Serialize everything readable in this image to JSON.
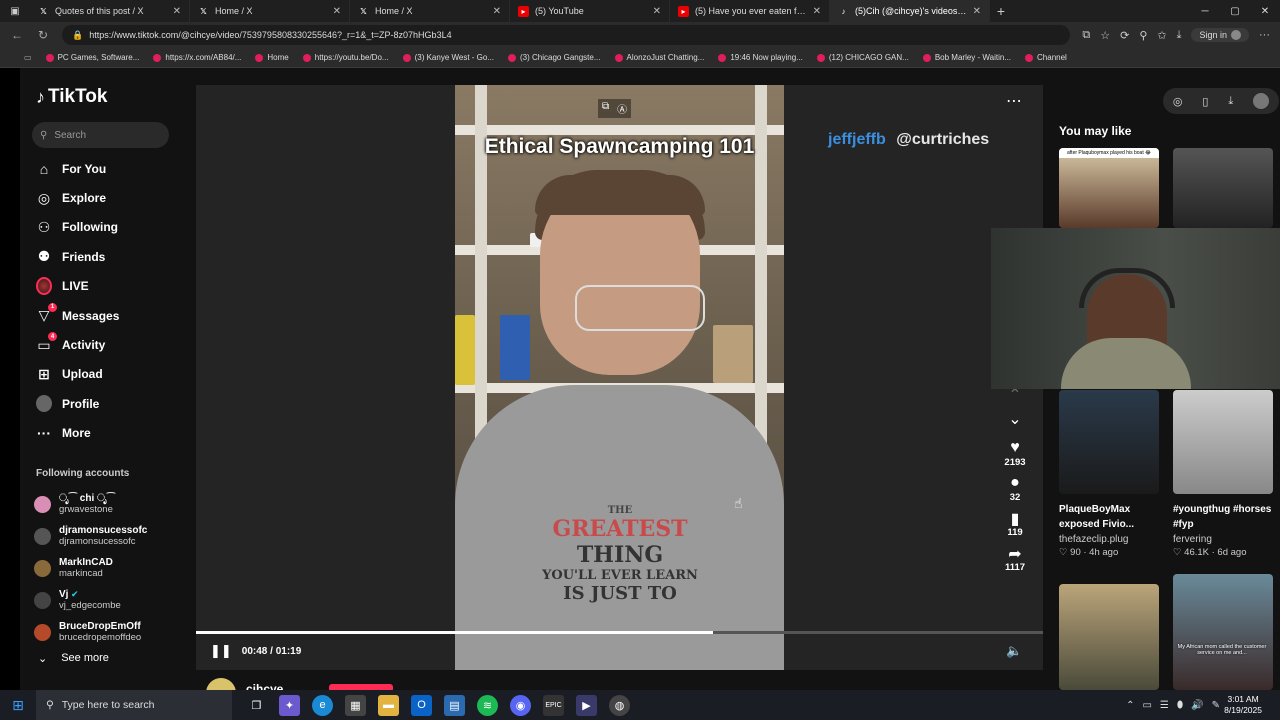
{
  "browser": {
    "tabs": [
      {
        "label": "Quotes of this post / X",
        "icon": "x-logo-icon",
        "active": false
      },
      {
        "label": "Home / X",
        "icon": "x-logo-icon",
        "active": false
      },
      {
        "label": "Home / X",
        "icon": "x-logo-icon",
        "active": false
      },
      {
        "label": "(5) YouTube",
        "icon": "youtube-icon",
        "active": false
      },
      {
        "label": "(5) Have you ever eaten fish this",
        "icon": "youtube-icon",
        "active": false
      },
      {
        "label": "(5)Cih (@cihcye)'s videos wi",
        "icon": "tiktok-icon",
        "active": true
      }
    ],
    "url": "https://www.tiktok.com/@cihcye/video/7539795808330255646?_r=1&_t=ZP-8z07hHGb3L4",
    "signin_label": "Sign in",
    "bookmarks": [
      {
        "label": "PC Games, Software..."
      },
      {
        "label": "https://x.com/AB84/..."
      },
      {
        "label": "Home"
      },
      {
        "label": "https://youtu.be/Do..."
      },
      {
        "label": "(3) Kanye West - Go..."
      },
      {
        "label": "(3) Chicago Gangste..."
      },
      {
        "label": "AlonzoJust Chatting..."
      },
      {
        "label": "19:46 Now playing..."
      },
      {
        "label": "(12) CHICAGO GAN..."
      },
      {
        "label": "Bob Marley - Waitin..."
      },
      {
        "label": "Channel"
      }
    ]
  },
  "sidebar": {
    "logo": "TikTok",
    "search_placeholder": "Search",
    "nav": [
      {
        "label": "For You",
        "icon": "home-icon"
      },
      {
        "label": "Explore",
        "icon": "compass-icon"
      },
      {
        "label": "Following",
        "icon": "following-icon"
      },
      {
        "label": "Friends",
        "icon": "friends-icon"
      },
      {
        "label": "LIVE",
        "icon": "live-avatar-icon"
      },
      {
        "label": "Messages",
        "icon": "messages-icon",
        "badge": "1"
      },
      {
        "label": "Activity",
        "icon": "activity-icon",
        "badge": "4"
      },
      {
        "label": "Upload",
        "icon": "upload-icon"
      },
      {
        "label": "Profile",
        "icon": "profile-avatar-icon"
      },
      {
        "label": "More",
        "icon": "more-dots-icon"
      }
    ],
    "following_title": "Following accounts",
    "following": [
      {
        "name": "ೃ⁀ chi ೃ⁀",
        "handle": "grwavestone",
        "color": "#d98fb5"
      },
      {
        "name": "djramonsucessofc",
        "handle": "djramonsucessofc",
        "color": "#555"
      },
      {
        "name": "MarkInCAD",
        "handle": "markincad",
        "color": "#8a6a3a"
      },
      {
        "name": "Vj",
        "handle": "vj_edgecombe",
        "color": "#444",
        "verified": true
      },
      {
        "name": "BruceDropEmOff",
        "handle": "brucedropemoffdeo",
        "color": "#b54a2a"
      }
    ],
    "see_more": "See more"
  },
  "video": {
    "overlay_title": "Ethical Spawncamping 101",
    "credit_1": "jeffjeffb",
    "credit_2": "@curtriches",
    "shirt_line1": "THE",
    "shirt_line2": "GREATEST",
    "shirt_line3": "THING",
    "shirt_line4": "YOU'LL EVER LEARN",
    "shirt_line5": "IS JUST TO",
    "time": "00:48 / 01:19",
    "progress": 0.61,
    "likes": "2193",
    "comments": "32",
    "saves": "119",
    "shares": "1117",
    "creator_name": "cihcye"
  },
  "right": {
    "you_may_like": "You may like",
    "thumb1_caption": "after Plaquboymax played his boat 😂",
    "thumb3_caption": "PlaqueBoyMax exposed Fivio...",
    "thumb3_user": "thefazeclip.plug",
    "thumb3_meta": "♡ 90 · 4h ago",
    "thumb4_caption": "#youngthug #horses #fyp",
    "thumb4_user": "fervering",
    "thumb4_meta": "♡ 46.1K · 6d ago",
    "thumb6_caption": "My African mom called the customer service on me and..."
  },
  "taskbar": {
    "search_placeholder": "Type here to search",
    "time": "3:01 AM",
    "date": "8/19/2025"
  }
}
